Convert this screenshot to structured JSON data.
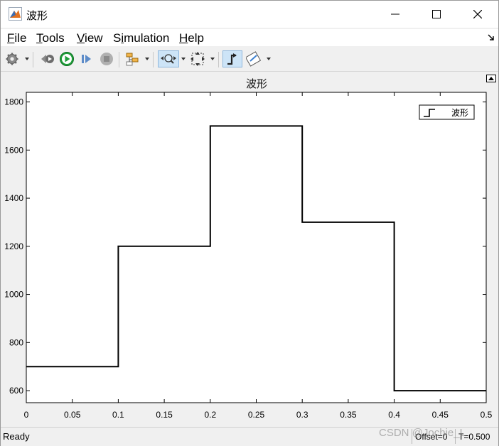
{
  "window": {
    "title": "波形",
    "controls": [
      "minimize",
      "maximize",
      "close"
    ]
  },
  "menu": {
    "items": [
      {
        "label": "File",
        "accel": "F"
      },
      {
        "label": "Tools",
        "accel": "T"
      },
      {
        "label": "View",
        "accel": "V"
      },
      {
        "label": "Simulation",
        "accel": "i"
      },
      {
        "label": "Help",
        "accel": "H"
      }
    ]
  },
  "toolbar": {
    "icons": [
      "gear-icon",
      "step-back-icon",
      "run-icon",
      "step-forward-icon",
      "stop-icon",
      "highlight-model-icon",
      "zoom-icon",
      "fit-to-view-icon",
      "cursor-measurement-icon",
      "style-icon"
    ]
  },
  "plot": {
    "title": "波形"
  },
  "status": {
    "ready": "Ready",
    "offset": "Offset=0",
    "time": "T=0.500"
  },
  "watermark": "CSDN @Jochie_L",
  "chart_data": {
    "type": "line",
    "step": true,
    "title": "波形",
    "xlabel": "",
    "ylabel": "",
    "xlim": [
      0,
      0.5
    ],
    "ylim": [
      550,
      1840
    ],
    "x_ticks": [
      0,
      0.05,
      0.1,
      0.15,
      0.2,
      0.25,
      0.3,
      0.35,
      0.4,
      0.45,
      0.5
    ],
    "x_tick_labels": [
      "0",
      "0.05",
      "0.1",
      "0.15",
      "0.2",
      "0.25",
      "0.3",
      "0.35",
      "0.4",
      "0.45",
      "0.5"
    ],
    "y_ticks": [
      600,
      800,
      1000,
      1200,
      1400,
      1600,
      1800
    ],
    "y_tick_labels": [
      "600",
      "800",
      "1000",
      "1200",
      "1400",
      "1600",
      "1800"
    ],
    "legend": {
      "placement": "top-right"
    },
    "grid": false,
    "series": [
      {
        "name": "波形",
        "color": "#000000",
        "x": [
          0,
          0.1,
          0.1,
          0.2,
          0.2,
          0.3,
          0.3,
          0.4,
          0.4,
          0.5
        ],
        "y": [
          700,
          700,
          1200,
          1200,
          1700,
          1700,
          1300,
          1300,
          600,
          600
        ]
      }
    ]
  }
}
